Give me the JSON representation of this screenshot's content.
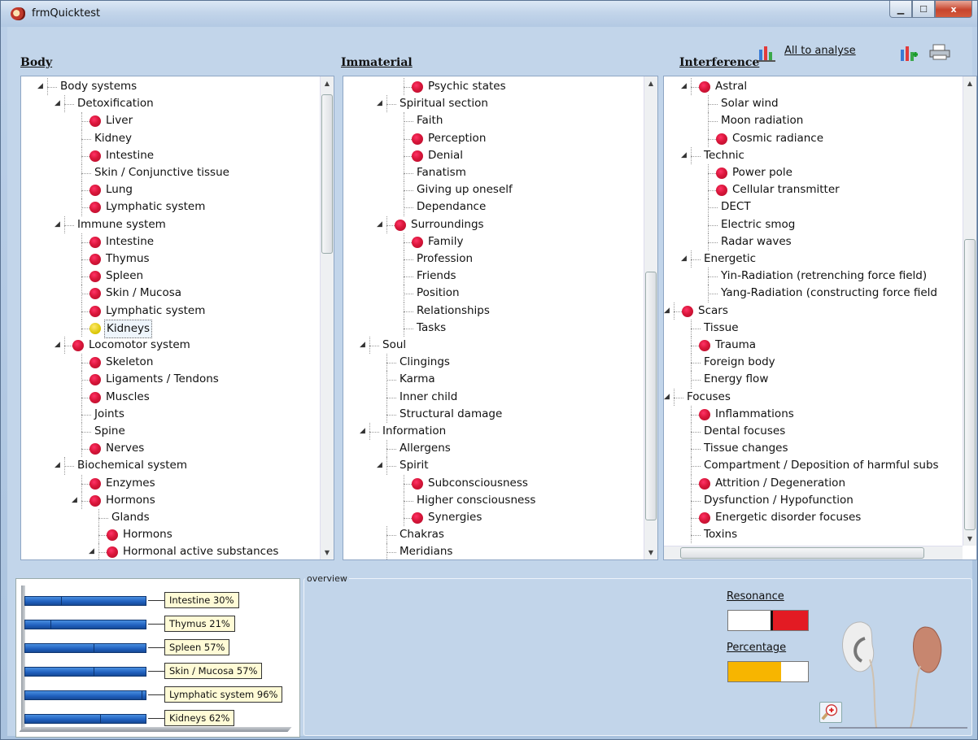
{
  "window": {
    "title": "frmQuicktest",
    "minimize_icon": "minimize-icon",
    "maximize_icon": "maximize-icon",
    "close_glyph": "x"
  },
  "columns": {
    "body": "Body",
    "immaterial": "Immaterial",
    "interference": "Interference"
  },
  "toolbar": {
    "analyse_label": "All to analyse"
  },
  "colors": {
    "marker_red": "#d9163a",
    "marker_yellow": "#d8c400",
    "bar_blue": "#1f5fbd",
    "resonance_red": "#e31b23",
    "percentage_orange": "#f7b500"
  },
  "trees": {
    "body": [
      {
        "label": "Body systems",
        "level": 0,
        "expander": "open",
        "dot": ""
      },
      {
        "label": "Detoxification",
        "level": 1,
        "expander": "open",
        "dot": ""
      },
      {
        "label": "Liver",
        "level": 2,
        "expander": "",
        "dot": "red"
      },
      {
        "label": "Kidney",
        "level": 2,
        "expander": "",
        "dot": ""
      },
      {
        "label": "Intestine",
        "level": 2,
        "expander": "",
        "dot": "red"
      },
      {
        "label": "Skin / Conjunctive tissue",
        "level": 2,
        "expander": "",
        "dot": ""
      },
      {
        "label": "Lung",
        "level": 2,
        "expander": "",
        "dot": "red"
      },
      {
        "label": "Lymphatic system",
        "level": 2,
        "expander": "",
        "dot": "red"
      },
      {
        "label": "Immune system",
        "level": 1,
        "expander": "open",
        "dot": ""
      },
      {
        "label": "Intestine",
        "level": 2,
        "expander": "",
        "dot": "red"
      },
      {
        "label": "Thymus",
        "level": 2,
        "expander": "",
        "dot": "red"
      },
      {
        "label": "Spleen",
        "level": 2,
        "expander": "",
        "dot": "red"
      },
      {
        "label": "Skin / Mucosa",
        "level": 2,
        "expander": "",
        "dot": "red"
      },
      {
        "label": "Lymphatic system",
        "level": 2,
        "expander": "",
        "dot": "red"
      },
      {
        "label": "Kidneys",
        "level": 2,
        "expander": "",
        "dot": "yellow",
        "selected": true
      },
      {
        "label": "Locomotor system",
        "level": 1,
        "expander": "open",
        "dot": "red"
      },
      {
        "label": "Skeleton",
        "level": 2,
        "expander": "",
        "dot": "red"
      },
      {
        "label": "Ligaments / Tendons",
        "level": 2,
        "expander": "",
        "dot": "red"
      },
      {
        "label": "Muscles",
        "level": 2,
        "expander": "",
        "dot": "red"
      },
      {
        "label": "Joints",
        "level": 2,
        "expander": "",
        "dot": ""
      },
      {
        "label": "Spine",
        "level": 2,
        "expander": "",
        "dot": ""
      },
      {
        "label": "Nerves",
        "level": 2,
        "expander": "",
        "dot": "red"
      },
      {
        "label": "Biochemical system",
        "level": 1,
        "expander": "open",
        "dot": ""
      },
      {
        "label": "Enzymes",
        "level": 2,
        "expander": "",
        "dot": "red"
      },
      {
        "label": "Hormons",
        "level": 2,
        "expander": "open",
        "dot": "red"
      },
      {
        "label": "Glands",
        "level": 3,
        "expander": "",
        "dot": ""
      },
      {
        "label": "Hormons",
        "level": 3,
        "expander": "",
        "dot": "red"
      },
      {
        "label": "Hormonal active substances",
        "level": 3,
        "expander": "open",
        "dot": "red"
      }
    ],
    "immaterial": [
      {
        "label": "Psychic states",
        "level": 2,
        "expander": "",
        "dot": "red"
      },
      {
        "label": "Spiritual section",
        "level": 1,
        "expander": "open",
        "dot": ""
      },
      {
        "label": "Faith",
        "level": 2,
        "expander": "",
        "dot": ""
      },
      {
        "label": "Perception",
        "level": 2,
        "expander": "",
        "dot": "red"
      },
      {
        "label": "Denial",
        "level": 2,
        "expander": "",
        "dot": "red"
      },
      {
        "label": "Fanatism",
        "level": 2,
        "expander": "",
        "dot": ""
      },
      {
        "label": "Giving up oneself",
        "level": 2,
        "expander": "",
        "dot": ""
      },
      {
        "label": "Dependance",
        "level": 2,
        "expander": "",
        "dot": ""
      },
      {
        "label": "Surroundings",
        "level": 1,
        "expander": "open",
        "dot": "red"
      },
      {
        "label": "Family",
        "level": 2,
        "expander": "",
        "dot": "red"
      },
      {
        "label": "Profession",
        "level": 2,
        "expander": "",
        "dot": ""
      },
      {
        "label": "Friends",
        "level": 2,
        "expander": "",
        "dot": ""
      },
      {
        "label": "Position",
        "level": 2,
        "expander": "",
        "dot": ""
      },
      {
        "label": "Relationships",
        "level": 2,
        "expander": "",
        "dot": ""
      },
      {
        "label": "Tasks",
        "level": 2,
        "expander": "",
        "dot": ""
      },
      {
        "label": "Soul",
        "level": 0,
        "expander": "open",
        "dot": ""
      },
      {
        "label": "Clingings",
        "level": 1,
        "expander": "",
        "dot": ""
      },
      {
        "label": "Karma",
        "level": 1,
        "expander": "",
        "dot": ""
      },
      {
        "label": "Inner child",
        "level": 1,
        "expander": "",
        "dot": ""
      },
      {
        "label": "Structural damage",
        "level": 1,
        "expander": "",
        "dot": ""
      },
      {
        "label": "Information",
        "level": 0,
        "expander": "open",
        "dot": ""
      },
      {
        "label": "Allergens",
        "level": 1,
        "expander": "",
        "dot": ""
      },
      {
        "label": "Spirit",
        "level": 1,
        "expander": "open",
        "dot": ""
      },
      {
        "label": "Subconsciousness",
        "level": 2,
        "expander": "",
        "dot": "red"
      },
      {
        "label": "Higher consciousness",
        "level": 2,
        "expander": "",
        "dot": ""
      },
      {
        "label": "Synergies",
        "level": 2,
        "expander": "",
        "dot": "red"
      },
      {
        "label": "Chakras",
        "level": 1,
        "expander": "",
        "dot": ""
      },
      {
        "label": "Meridians",
        "level": 1,
        "expander": "",
        "dot": ""
      }
    ],
    "interference": [
      {
        "label": "Astral",
        "level": 1,
        "expander": "open",
        "dot": "red"
      },
      {
        "label": "Solar wind",
        "level": 2,
        "expander": "",
        "dot": ""
      },
      {
        "label": "Moon radiation",
        "level": 2,
        "expander": "",
        "dot": ""
      },
      {
        "label": "Cosmic radiance",
        "level": 2,
        "expander": "",
        "dot": "red"
      },
      {
        "label": "Technic",
        "level": 1,
        "expander": "open",
        "dot": ""
      },
      {
        "label": "Power pole",
        "level": 2,
        "expander": "",
        "dot": "red"
      },
      {
        "label": "Cellular transmitter",
        "level": 2,
        "expander": "",
        "dot": "red"
      },
      {
        "label": "DECT",
        "level": 2,
        "expander": "",
        "dot": ""
      },
      {
        "label": "Electric smog",
        "level": 2,
        "expander": "",
        "dot": ""
      },
      {
        "label": "Radar waves",
        "level": 2,
        "expander": "",
        "dot": ""
      },
      {
        "label": "Energetic",
        "level": 1,
        "expander": "open",
        "dot": ""
      },
      {
        "label": "Yin-Radiation (retrenching force field)",
        "level": 2,
        "expander": "",
        "dot": ""
      },
      {
        "label": "Yang-Radiation (constructing force field",
        "level": 2,
        "expander": "",
        "dot": ""
      },
      {
        "label": "Scars",
        "level": 0,
        "expander": "open",
        "dot": "red"
      },
      {
        "label": "Tissue",
        "level": 1,
        "expander": "",
        "dot": ""
      },
      {
        "label": "Trauma",
        "level": 1,
        "expander": "",
        "dot": "red"
      },
      {
        "label": "Foreign body",
        "level": 1,
        "expander": "",
        "dot": ""
      },
      {
        "label": "Energy flow",
        "level": 1,
        "expander": "",
        "dot": ""
      },
      {
        "label": "Focuses",
        "level": 0,
        "expander": "open",
        "dot": ""
      },
      {
        "label": "Inflammations",
        "level": 1,
        "expander": "",
        "dot": "red"
      },
      {
        "label": "Dental focuses",
        "level": 1,
        "expander": "",
        "dot": ""
      },
      {
        "label": "Tissue changes",
        "level": 1,
        "expander": "",
        "dot": ""
      },
      {
        "label": "Compartment / Deposition of harmful subs",
        "level": 1,
        "expander": "",
        "dot": ""
      },
      {
        "label": "Attrition / Degeneration",
        "level": 1,
        "expander": "",
        "dot": "red"
      },
      {
        "label": "Dysfunction / Hypofunction",
        "level": 1,
        "expander": "",
        "dot": ""
      },
      {
        "label": "Energetic disorder focuses",
        "level": 1,
        "expander": "",
        "dot": "red"
      },
      {
        "label": "Toxins",
        "level": 1,
        "expander": "",
        "dot": ""
      }
    ]
  },
  "chart_data": {
    "type": "bar",
    "orientation": "horizontal",
    "categories": [
      "Intestine",
      "Thymus",
      "Spleen",
      "Skin / Mucosa",
      "Lymphatic system",
      "Kidneys"
    ],
    "values": [
      30,
      21,
      57,
      57,
      96,
      62
    ],
    "labels": [
      "Intestine 30%",
      "Thymus 21%",
      "Spleen 57%",
      "Skin / Mucosa 57%",
      "Lymphatic system 96%",
      "Kidneys 62%"
    ],
    "unit": "%"
  },
  "overview": {
    "legend": "overview",
    "resonance_label": "Resonance",
    "resonance_value": 0.53,
    "percentage_label": "Percentage",
    "percentage_value": 0.66
  }
}
